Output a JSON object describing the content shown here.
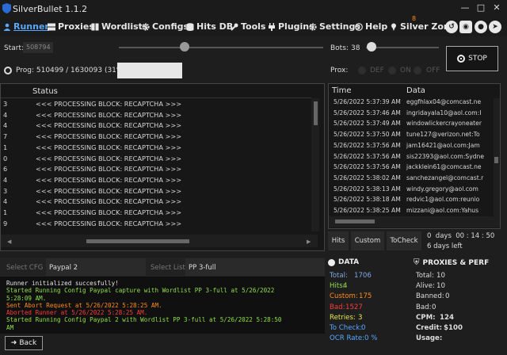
{
  "app": {
    "title": "SilverBullet 1.1.2",
    "logo_color": "#2b6bd6"
  },
  "nav": {
    "items": [
      {
        "label": "Runner",
        "icon": "person-icon",
        "active": true
      },
      {
        "label": "Proxies",
        "icon": "server-icon"
      },
      {
        "label": "Wordlists",
        "icon": "book-icon"
      },
      {
        "label": "Configs",
        "icon": "gear-icon"
      },
      {
        "label": "Hits DB",
        "icon": "database-icon"
      },
      {
        "label": "Tools",
        "icon": "wrench-icon"
      },
      {
        "label": "Plugins",
        "icon": "plug-icon"
      },
      {
        "label": "Settings",
        "icon": "gear-icon"
      },
      {
        "label": "Help",
        "icon": "question-icon"
      },
      {
        "label": "Silver Zone",
        "icon": "pin-icon"
      }
    ],
    "badge": "8",
    "accent": "#58a8ff"
  },
  "controls": {
    "start_label": "Start:",
    "start_value": "508794",
    "bots_label": "Bots:",
    "bots_value": "38",
    "stop_label": "STOP",
    "prog_label": "Prog: 510499 / 1630093 (31%)",
    "progress_fraction": 0.31,
    "prox_label": "Prox:",
    "prox_options": [
      "DEF",
      "ON",
      "OFF"
    ]
  },
  "status": {
    "headers": [
      "",
      "Status"
    ],
    "rows": [
      {
        "n": "3",
        "s": "<<< PROCESSING BLOCK: RECAPTCHA >>>"
      },
      {
        "n": "4",
        "s": "<<< PROCESSING BLOCK: RECAPTCHA >>>"
      },
      {
        "n": "4",
        "s": "<<< PROCESSING BLOCK: RECAPTCHA >>>"
      },
      {
        "n": "7",
        "s": "<<< PROCESSING BLOCK: RECAPTCHA >>>"
      },
      {
        "n": "1",
        "s": "<<< PROCESSING BLOCK: RECAPTCHA >>>"
      },
      {
        "n": "0",
        "s": "<<< PROCESSING BLOCK: RECAPTCHA >>>"
      },
      {
        "n": "6",
        "s": "<<< PROCESSING BLOCK: RECAPTCHA >>>"
      },
      {
        "n": "4",
        "s": "<<< PROCESSING BLOCK: RECAPTCHA >>>"
      },
      {
        "n": "3",
        "s": "<<< PROCESSING BLOCK: RECAPTCHA >>>"
      },
      {
        "n": "4",
        "s": "<<< PROCESSING BLOCK: RECAPTCHA >>>"
      },
      {
        "n": "1",
        "s": "<<< PROCESSING BLOCK: RECAPTCHA >>>"
      },
      {
        "n": "9",
        "s": "<<< PROCESSING BLOCK: RECAPTCHA >>>"
      }
    ]
  },
  "hits": {
    "headers": [
      "Time",
      "Data"
    ],
    "rows": [
      {
        "t": "5/26/2022 5:37:39 AM",
        "d": "eggfhlax04@comcast.ne"
      },
      {
        "t": "5/26/2022 5:37:46 AM",
        "d": "ingridayala10@aol.com:I"
      },
      {
        "t": "5/26/2022 5:37:49 AM",
        "d": "windowlickercrayoneater"
      },
      {
        "t": "5/26/2022 5:37:50 AM",
        "d": "tune127@verizon.net:To"
      },
      {
        "t": "5/26/2022 5:37:56 AM",
        "d": "jam16421@aol.com:Jam"
      },
      {
        "t": "5/26/2022 5:37:56 AM",
        "d": "sis22393@aol.com:Sydne"
      },
      {
        "t": "5/26/2022 5:37:56 AM",
        "d": "jackklein61@comcast.ne"
      },
      {
        "t": "5/26/2022 5:38:02 AM",
        "d": "sanchezangel@comcast.r"
      },
      {
        "t": "5/26/2022 5:38:13 AM",
        "d": "windy.gregory@aol.com"
      },
      {
        "t": "5/26/2022 5:38:18 AM",
        "d": "redvic1@aol.com:reunio"
      },
      {
        "t": "5/26/2022 5:38:25 AM",
        "d": "mizzani@aol.com:Yahus"
      }
    ],
    "tabs": [
      "Hits",
      "Custom",
      "ToCheck"
    ],
    "timer": "0  days  00 : 14 : 50",
    "left": "6 days left"
  },
  "config": {
    "select_cfg_placeholder": "Select CFG",
    "cfg_value": "Paypal 2",
    "select_list_placeholder": "Select List",
    "list_value": "PP 3-full"
  },
  "log": {
    "lines": [
      {
        "text": "Runner initialized succesfully!",
        "color": "#e6e6e6"
      },
      {
        "text": "Started Running Config Paypal capture with Wordlist PP 3-full at 5/26/2022\n5:28:09 AM.",
        "color": "#8fe04a"
      },
      {
        "text": "Sent Abort Request at 5/26/2022 5:28:25 AM.",
        "color": "#ff8c1a"
      },
      {
        "text": "Aborted Runner at 5/26/2022 5:28:25 AM.",
        "color": "#ff3b3b"
      },
      {
        "text": "Started Running Config Paypal 2 with Wordlist PP 3-full at 5/26/2022 5:28:50\nAM",
        "color": "#8fe04a"
      }
    ]
  },
  "back_label": "Back",
  "data_stats": {
    "title": "DATA",
    "items": [
      {
        "label": "Total:",
        "value": "1706",
        "color": "#7ea7e6"
      },
      {
        "label": "Hits:",
        "value": "4",
        "color": "#8fe04a"
      },
      {
        "label": "Custom:",
        "value": "175",
        "color": "#ff8c1a"
      },
      {
        "label": "Bad:",
        "value": "1527",
        "color": "#ff3b3b"
      },
      {
        "label": "Retries:",
        "value": "3",
        "color": "#e8e84a"
      },
      {
        "label": "To Check:",
        "value": "0",
        "color": "#58a8ff"
      },
      {
        "label": "OCR Rate:",
        "value": "0 %",
        "color": "#58a8ff"
      }
    ]
  },
  "proxy_stats": {
    "title": "PROXIES & PERF",
    "items": [
      {
        "label": "Total:",
        "value": "10"
      },
      {
        "label": "Alive:",
        "value": "10"
      },
      {
        "label": "Banned:",
        "value": "0"
      },
      {
        "label": "Bad:",
        "value": "0"
      },
      {
        "label": "CPM:",
        "value": "124",
        "bold": true
      },
      {
        "label": "Credit:",
        "value": "$100",
        "bold": true
      },
      {
        "label": "Usage:",
        "value": "",
        "bold": true
      }
    ]
  }
}
